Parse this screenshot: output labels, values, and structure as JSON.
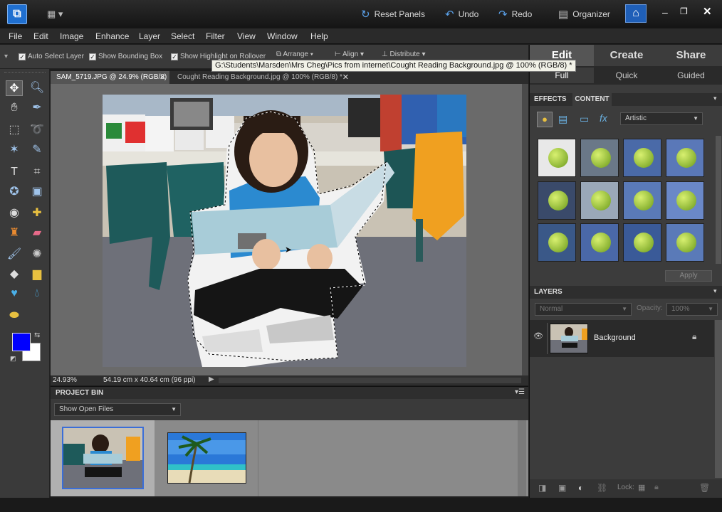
{
  "topbar": {
    "reset_panels": "Reset Panels",
    "undo": "Undo",
    "redo": "Redo",
    "organizer": "Organizer"
  },
  "menu": [
    "File",
    "Edit",
    "Image",
    "Enhance",
    "Layer",
    "Select",
    "Filter",
    "View",
    "Window",
    "Help"
  ],
  "options": {
    "auto_select_layer": "Auto Select Layer",
    "show_bounding_box": "Show Bounding Box",
    "show_highlight": "Show Highlight on Rollover",
    "arrange": "Arrange",
    "align": "Align",
    "distribute": "Distribute"
  },
  "tooltip": "G:\\Students\\Marsden\\Mrs Cheg\\Pics from internet\\Cought Reading Background.jpg @ 100% (RGB/8) *",
  "doc_tabs": [
    {
      "label": "SAM_5719.JPG @ 24.9% (RGB/8)",
      "active": true
    },
    {
      "label": "Cought Reading Background.jpg @ 100% (RGB/8) *",
      "active": false
    }
  ],
  "status": {
    "zoom": "24.93%",
    "doc_size": "54.19 cm x 40.64 cm (96 ppi)"
  },
  "project_bin": {
    "title": "PROJECT BIN",
    "show_option": "Show Open Files"
  },
  "right_panel": {
    "mode_tabs": [
      "Edit",
      "Create",
      "Share"
    ],
    "sub_tabs": [
      "Full",
      "Quick",
      "Guided"
    ],
    "effects_tab": "EFFECTS",
    "content_tab": "CONTENT",
    "effects_category": "Artistic",
    "apply": "Apply",
    "layers_title": "LAYERS",
    "blend_mode": "Normal",
    "opacity_label": "Opacity:",
    "opacity_value": "100%",
    "layer_name": "Background",
    "lock_label": "Lock:"
  },
  "colors": {
    "foreground": "#0000ff",
    "background": "#ffffff",
    "accent": "#5aa0e8"
  }
}
